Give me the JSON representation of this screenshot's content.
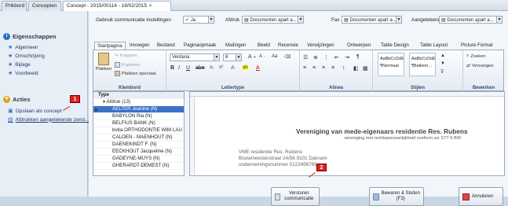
{
  "tabs": [
    {
      "label": "Prikbord"
    },
    {
      "label": "Concepten"
    },
    {
      "label": "Concept - 2015/00114 - 18/02/2015"
    }
  ],
  "left_pane": {
    "properties_header": "Eigenschappen",
    "properties_items": [
      "Algemeen",
      "Omschrijving",
      "Bijlage",
      "Voorbeeld"
    ],
    "actions_header": "Acties",
    "actions_items": [
      "Opslaan als concept",
      "Afdrukken aangetekende zend..."
    ]
  },
  "settings_row": {
    "gebruik_label": "Gebruik communicatie instellingen",
    "gebruik_value": "Ja",
    "afdruk_label": "Afdruk",
    "afdruk_value": "Documenten apart a...",
    "fax_label": "Fax",
    "fax_value": "Documenten apart a...",
    "aangetekend_label": "Aangetekend",
    "aangetekend_value": "Documenten apart a..."
  },
  "ribbon": {
    "tabs": [
      "Startpagina",
      "Invoegen",
      "Bestand",
      "Paginaopmaak",
      "Mailingen",
      "Beeld",
      "Recensie",
      "Verwijzingen",
      "Ontwerpen",
      "Table Design",
      "Table Layout",
      "Picture Format"
    ],
    "active_tab": "Startpagina",
    "groups": {
      "klembord": "Klembord",
      "lettertype": "Lettertype",
      "alinea": "Alinea",
      "stijlen": "Stijlen",
      "bewerken": "Bewerken"
    },
    "plakken": "Plakken",
    "knippen": "Knippen",
    "kopieren": "Kopiëren",
    "plakken_speciaal": "Plakken speciaal",
    "font_name": "Verdana",
    "font_size": "8",
    "style1_sample": "AaBbCcDdE",
    "style1_name": "¶Normaal",
    "style2_sample": "AaBbCcDdE",
    "style2_name": "¶Balloon...",
    "zoeken": "Zoeken",
    "vervangen": "Vervangen"
  },
  "tree": {
    "header": "Type",
    "group_label": "Afdruk (13)",
    "items": [
      "AELTER Jeanine (N)",
      "BABYLON Ria (N)",
      "BELFIUS BANK (N)",
      "bvba ORTHODONTIE WIM LAU",
      "CALOEN - MAENHOUT (N)",
      "DAENEKINDT F. (N)",
      "EECKHOUT Jacqueline (N)",
      "GADEYNE-MUYS (N)",
      "GHERARDT-DEMEST (N)"
    ]
  },
  "document": {
    "title": "Vereniging van mede-eigenaars residentie Res. Rubens",
    "subtitle": "vereniging met rechtspersoonlijkheid conform art. 577-5 BW",
    "address_lines": [
      "VME residentie Res. Rubens",
      "Bouwmeesterstraat 24/56 9101 Daknam",
      "ondernemingsnummer 0123456789"
    ]
  },
  "buttons": {
    "versturen": "Versturen communicatie",
    "bewaren": "Bewaren & Sluiten (F3)",
    "annuleren": "Annuleren"
  },
  "annotations": [
    "1",
    "2"
  ],
  "colors": {
    "annotation": "#e02020",
    "selection": "#3a73c9"
  }
}
